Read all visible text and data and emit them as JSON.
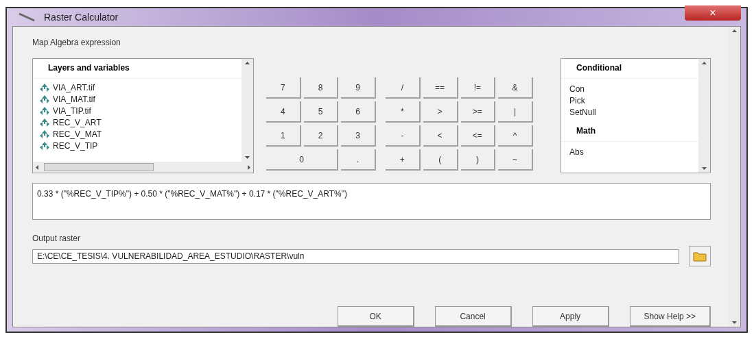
{
  "window": {
    "title": "Raster Calculator",
    "close": "×"
  },
  "section_label": "Map Algebra expression",
  "layers": {
    "header": "Layers and variables",
    "items": [
      "VIA_ART.tif",
      "VIA_MAT.tif",
      "VIA_TIP.tif",
      "REC_V_ART",
      "REC_V_MAT",
      "REC_V_TIP"
    ]
  },
  "keypad": {
    "digits": [
      [
        {
          "label": "7",
          "kind": "normal"
        },
        {
          "label": "8",
          "kind": "normal"
        },
        {
          "label": "9",
          "kind": "normal"
        }
      ],
      [
        {
          "label": "4",
          "kind": "normal"
        },
        {
          "label": "5",
          "kind": "normal"
        },
        {
          "label": "6",
          "kind": "normal"
        }
      ],
      [
        {
          "label": "1",
          "kind": "normal"
        },
        {
          "label": "2",
          "kind": "normal"
        },
        {
          "label": "3",
          "kind": "normal"
        }
      ],
      [
        {
          "label": "0",
          "kind": "wide"
        },
        {
          "label": ".",
          "kind": "normal"
        }
      ]
    ],
    "operators": [
      [
        "/",
        "==",
        "!=",
        "&"
      ],
      [
        "*",
        ">",
        ">=",
        "|"
      ],
      [
        "-",
        "<",
        "<=",
        "^"
      ],
      [
        "+",
        "(",
        ")",
        "~"
      ]
    ]
  },
  "functions": {
    "groups": [
      {
        "header": "Conditional",
        "items": [
          "Con",
          "Pick",
          "SetNull"
        ]
      },
      {
        "header": "Math",
        "items": [
          "Abs"
        ]
      }
    ]
  },
  "expression": "0.33 * (\"%REC_V_TIP%\") + 0.50 * (\"%REC_V_MAT%\") + 0.17 * (\"%REC_V_ART%\")",
  "output": {
    "label": "Output raster",
    "value": "E:\\CE\\CE_TESIS\\4. VULNERABILIDAD_AREA_ESTUDIO\\RASTER\\vuln"
  },
  "buttons": [
    "OK",
    "Cancel",
    "Apply",
    "Show Help >>"
  ]
}
